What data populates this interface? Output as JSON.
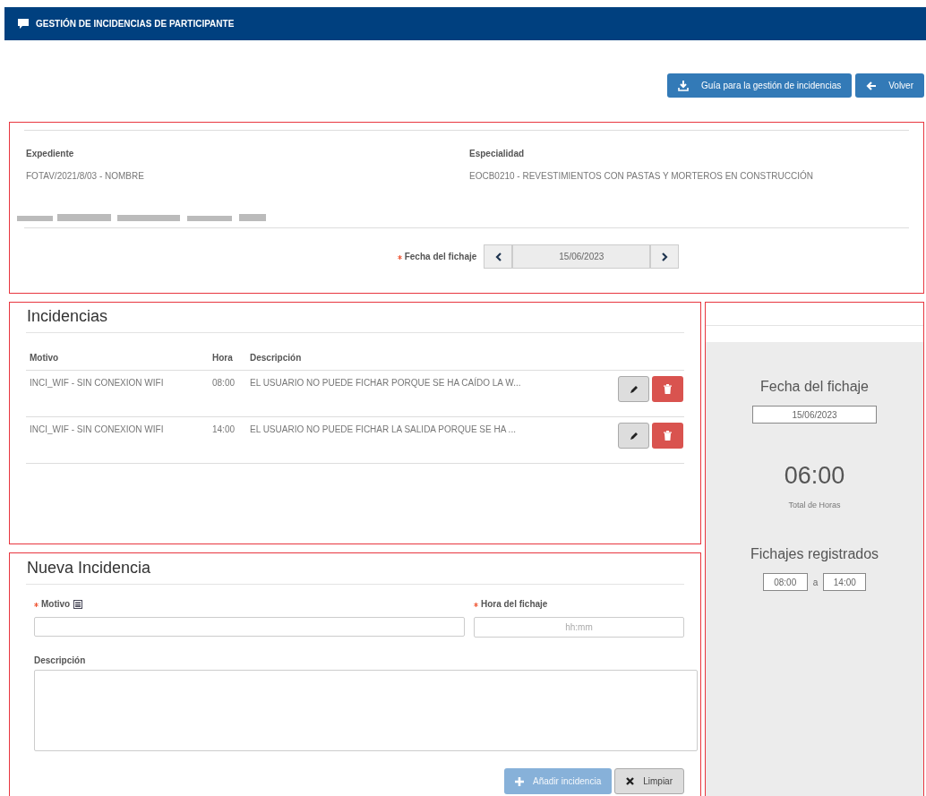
{
  "header": {
    "title": "GESTIÓN DE INCIDENCIAS DE PARTICIPANTE"
  },
  "actions": [
    {
      "label": "Guía para la gestión de incidencias",
      "kind": "download"
    },
    {
      "label": "Volver",
      "kind": "back"
    }
  ],
  "expediente": {
    "label": "Expediente",
    "value": "FOTAV/2021/8/03 - NOMBRE"
  },
  "especialidad": {
    "label": "Especialidad",
    "value": "EOCB0210 - REVESTIMIENTOS CON PASTAS Y MORTEROS EN CONSTRUCCIÓN"
  },
  "date_picker": {
    "label": "Fecha del fichaje",
    "required": true,
    "value": "15/06/2023"
  },
  "incidencias": {
    "title": "Incidencias",
    "columns": [
      "Motivo",
      "Hora",
      "Descripción"
    ],
    "rows": [
      {
        "motivo": "INCI_WIF - SIN CONEXION WIFI",
        "hora": "08:00",
        "descripcion": "EL USUARIO NO PUEDE FICHAR PORQUE SE HA CAÍDO LA W..."
      },
      {
        "motivo": "INCI_WIF - SIN CONEXION WIFI",
        "hora": "14:00",
        "descripcion": "EL USUARIO NO PUEDE FICHAR LA SALIDA PORQUE SE HA ..."
      }
    ]
  },
  "nueva": {
    "title": "Nueva Incidencia",
    "motivo": {
      "label": "Motivo",
      "required": true
    },
    "hora": {
      "label": "Hora del fichaje",
      "required": true,
      "placeholder": "hh:mm"
    },
    "descripcion": {
      "label": "Descripción"
    },
    "buttons": [
      {
        "label": "Añadir incidencia",
        "kind": "add",
        "disabled": true
      },
      {
        "label": "Limpiar",
        "kind": "clear",
        "disabled": false
      }
    ]
  },
  "summary": {
    "date_title": "Fecha del fichaje",
    "date": "15/06/2023",
    "total": "06:00",
    "total_label": "Total de Horas",
    "registered_title": "Fichajes registrados",
    "from": "08:00",
    "separator": "a",
    "to": "14:00"
  }
}
